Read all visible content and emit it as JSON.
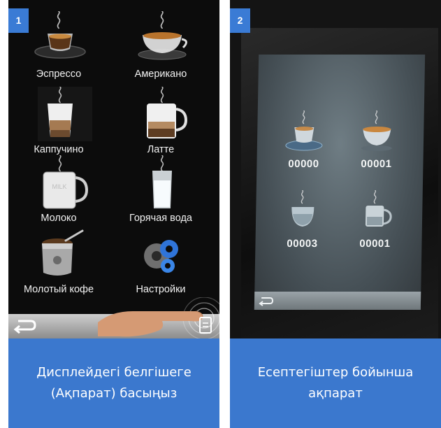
{
  "step1": {
    "badge": "1",
    "menu": [
      {
        "label": "Эспрессо",
        "icon": "espresso-cup-icon"
      },
      {
        "label": "Американо",
        "icon": "americano-cup-icon"
      },
      {
        "label": "Каппучино",
        "icon": "cappuccino-glass-icon"
      },
      {
        "label": "Латте",
        "icon": "latte-mug-icon"
      },
      {
        "label": "Молоко",
        "icon": "milk-mug-icon"
      },
      {
        "label": "Горячая вода",
        "icon": "hot-water-glass-icon"
      },
      {
        "label": "Молотый кофе",
        "icon": "ground-coffee-icon"
      },
      {
        "label": "Настройки",
        "icon": "settings-gears-icon"
      }
    ],
    "caption": "Дисплейдегі белгішеге (Ақпарат) басыңыз"
  },
  "step2": {
    "badge": "2",
    "counters": [
      {
        "value": "00000",
        "icon": "espresso-cup-icon"
      },
      {
        "value": "00001",
        "icon": "americano-cup-icon"
      },
      {
        "value": "00003",
        "icon": "cappuccino-glass-icon"
      },
      {
        "value": "00001",
        "icon": "latte-mug-icon"
      }
    ],
    "caption": "Есептегіштер бойынша ақпарат"
  },
  "colors": {
    "caption_bg": "#3b78ce",
    "badge_bg": "#3a7bd5",
    "screen_bg": "#0c0c0c"
  }
}
